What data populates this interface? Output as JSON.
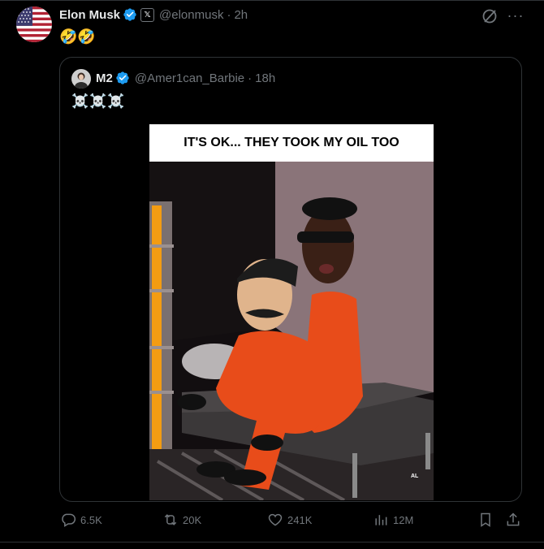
{
  "tweet": {
    "author": {
      "name": "Elon Musk",
      "handle": "@elonmusk",
      "time": "2h"
    },
    "separator": "·",
    "text": "🤣🤣",
    "more": "···",
    "quote": {
      "author": {
        "name": "M2",
        "handle": "@Amer1can_Barbie",
        "time": "18h"
      },
      "text": "☠️☠️☠️",
      "image": {
        "caption": "IT'S OK... THEY TOOK MY OIL TOO",
        "signature": "AL"
      }
    },
    "stats": {
      "replies": "6.5K",
      "reposts": "20K",
      "likes": "241K",
      "views": "12M"
    }
  },
  "colors": {
    "background": "#000000",
    "text": "#e7e9ea",
    "muted": "#71767b",
    "verified": "#1d9bf0",
    "border": "#2f3336"
  }
}
